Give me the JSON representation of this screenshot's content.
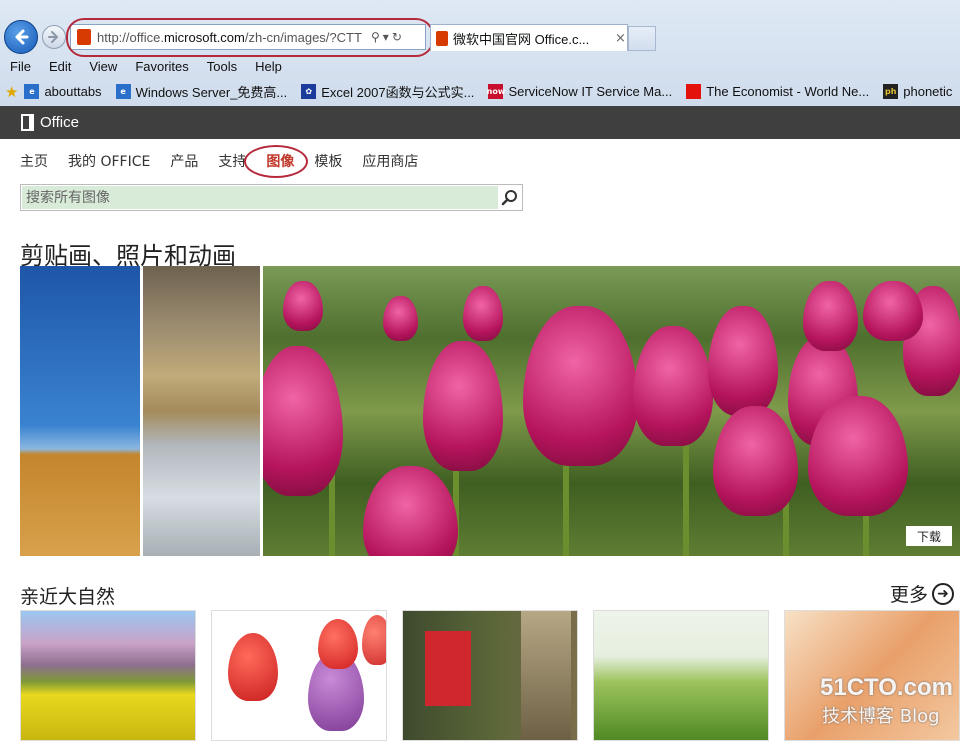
{
  "browser": {
    "address_url_prefix": "http://office.",
    "address_url_domain": "microsoft.com",
    "address_url_suffix": "/zh-cn/images/?CTT",
    "tab_title": "微软中国官网 Office.c...",
    "tab_close": "×",
    "menu": [
      "File",
      "Edit",
      "View",
      "Favorites",
      "Tools",
      "Help"
    ],
    "favorites": [
      {
        "label": "abouttabs",
        "icon": "ie-page-icon",
        "color": "#2a6fc9"
      },
      {
        "label": "Windows Server_免费高...",
        "icon": "ie-page-icon",
        "color": "#2a6fc9"
      },
      {
        "label": "Excel 2007函数与公式实...",
        "icon": "paw-icon",
        "color": "#1c3c9c"
      },
      {
        "label": "ServiceNow IT Service Ma...",
        "icon": "servicenow-icon",
        "color": "#c8102e"
      },
      {
        "label": "The Economist - World Ne...",
        "icon": "economist-icon",
        "color": "#e3120b"
      },
      {
        "label": "phonetic",
        "icon": "phonetic-icon",
        "color": "#222"
      }
    ]
  },
  "site": {
    "logo_text": "Office",
    "nav": [
      {
        "label": "主页",
        "name": "nav-home",
        "active": false
      },
      {
        "label": "我的 OFFICE",
        "name": "nav-my-office",
        "active": false
      },
      {
        "label": "产品",
        "name": "nav-products",
        "active": false
      },
      {
        "label": "支持",
        "name": "nav-support",
        "active": false
      },
      {
        "label": "图像",
        "name": "nav-images",
        "active": true
      },
      {
        "label": "模板",
        "name": "nav-templates",
        "active": false
      },
      {
        "label": "应用商店",
        "name": "nav-store",
        "active": false
      }
    ],
    "search_placeholder": "搜索所有图像",
    "hero_title": "剪贴画、照片和动画",
    "download_label": "下载",
    "section_title": "亲近大自然",
    "more_label": "更多",
    "watermark_line1": "51CTO.com",
    "watermark_line2": "技术博客 Blog"
  },
  "colors": {
    "active_nav": "#c0392b",
    "annotation": "#b52a3a",
    "office_bar": "#3f3f3f"
  }
}
